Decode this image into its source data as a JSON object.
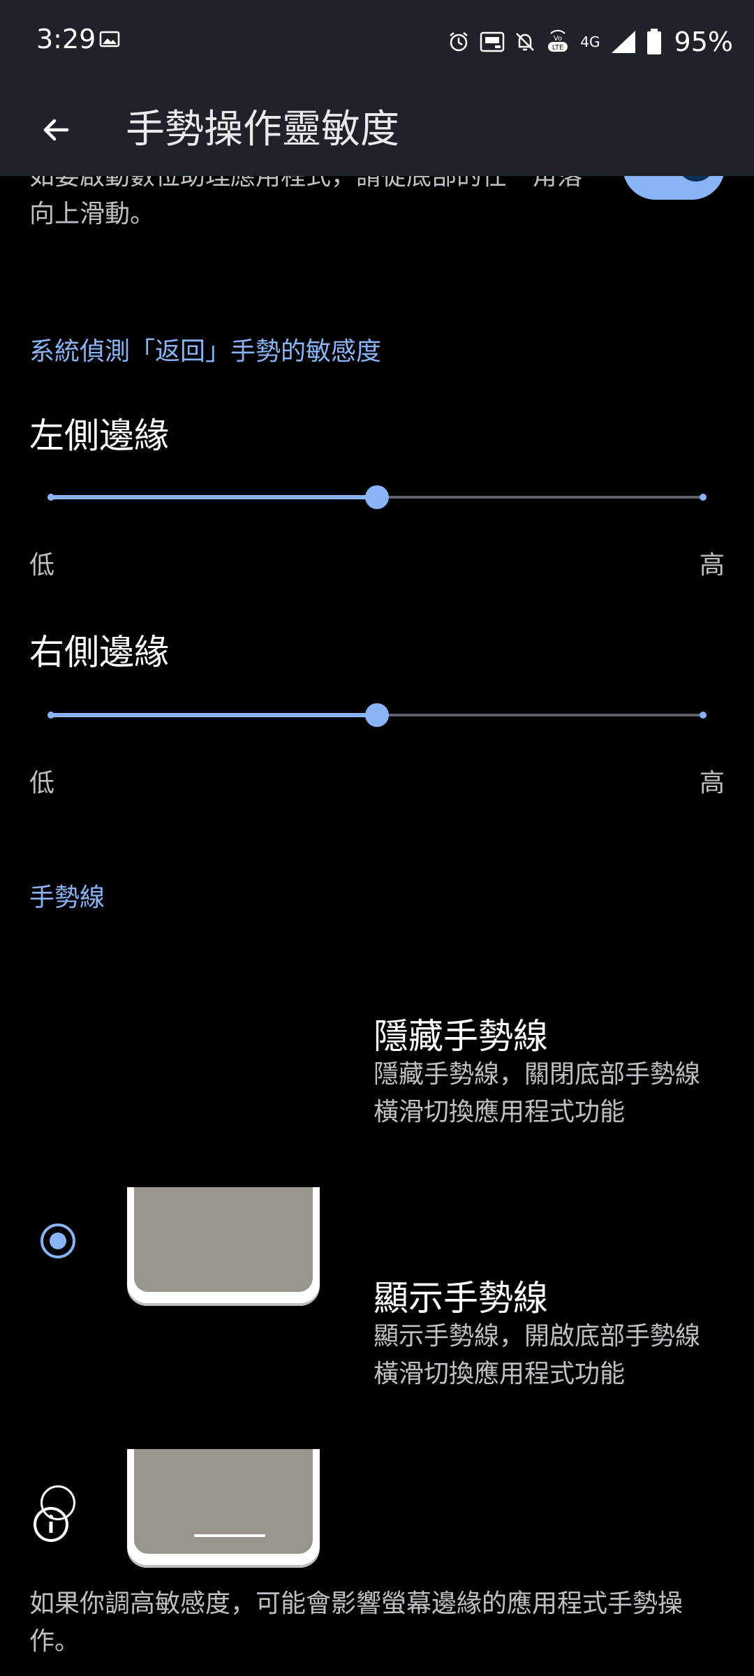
{
  "status_bar": {
    "time": "3:29",
    "network_label": "4G",
    "battery": "95%",
    "icons": [
      "image-icon",
      "alarm-icon",
      "auto-brightness-icon",
      "bell-off-icon",
      "volte-icon",
      "network-4g-icon",
      "signal-icon",
      "battery-icon"
    ]
  },
  "app_bar": {
    "title": "手勢操作靈敏度",
    "back_icon": "arrow-back-icon"
  },
  "intro": {
    "text": "如要啟動數位助理應用程式，請從底部的任一角落向上滑動。",
    "toggle_on": true
  },
  "back_gesture": {
    "header": "系統偵測「返回」手勢的敏感度",
    "left": {
      "title": "左側邊緣",
      "min_label": "低",
      "max_label": "高",
      "value_fraction": 0.5
    },
    "right": {
      "title": "右側邊緣",
      "min_label": "低",
      "max_label": "高",
      "value_fraction": 0.5
    }
  },
  "gesture_bar": {
    "header": "手勢線",
    "options": [
      {
        "title": "隱藏手勢線",
        "description": "隱藏手勢線，關閉底部手勢線橫滑切換應用程式功能",
        "selected": true
      },
      {
        "title": "顯示手勢線",
        "description": "顯示手勢線，開啟底部手勢線橫滑切換應用程式功能",
        "selected": false
      }
    ]
  },
  "footer": {
    "icon": "info-icon",
    "text": "如果你調高敏感度，可能會影響螢幕邊緣的應用程式手勢操作。"
  },
  "colors": {
    "accent": "#8ab4f8",
    "background": "#000000",
    "bar": "#1f2329",
    "secondary_text": "#bdc1c6"
  }
}
